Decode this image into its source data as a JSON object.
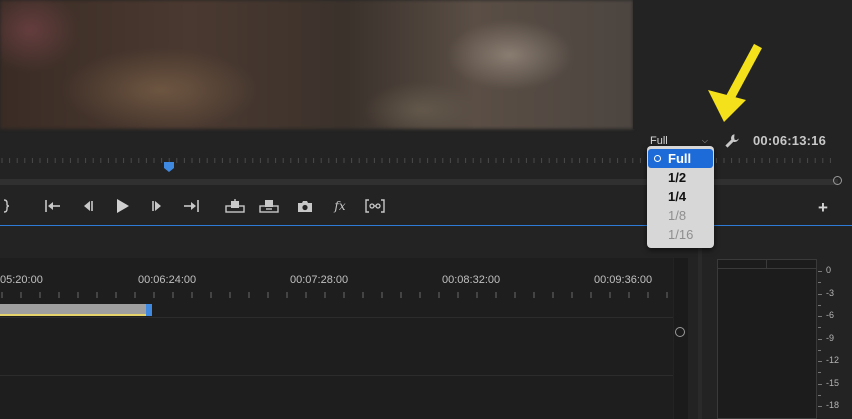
{
  "monitor": {
    "zoom_value": "Full",
    "timecode": "00:06:13:16",
    "zoom_options": [
      {
        "label": "Full",
        "selected": true,
        "enabled": true
      },
      {
        "label": "1/2",
        "selected": false,
        "enabled": true
      },
      {
        "label": "1/4",
        "selected": false,
        "enabled": true
      },
      {
        "label": "1/8",
        "selected": false,
        "enabled": false
      },
      {
        "label": "1/16",
        "selected": false,
        "enabled": false
      }
    ]
  },
  "transport": {
    "buttons": [
      "mark-out-icon",
      "go-to-in-icon",
      "step-back-icon",
      "play-icon",
      "step-forward-icon",
      "go-to-out-icon",
      "lift-icon",
      "extract-icon",
      "camera-icon",
      "fx-icon",
      "compare-icon"
    ],
    "add_label": "+",
    "fx_label": "fx"
  },
  "timeline": {
    "timecodes": [
      "05:20:00",
      "00:06:24:00",
      "00:07:28:00",
      "00:08:32:00",
      "00:09:36:00"
    ]
  },
  "audio_meter": {
    "db_labels": [
      "0",
      "-3",
      "-6",
      "-9",
      "-12",
      "-15",
      "-18"
    ]
  },
  "colors": {
    "accent": "#1c6bd8",
    "playhead": "#3f8ae0",
    "annotation_arrow": "#f4e01b"
  }
}
